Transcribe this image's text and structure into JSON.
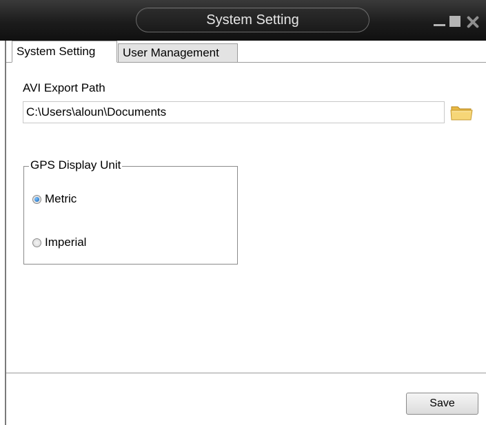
{
  "window": {
    "title": "System Setting"
  },
  "tabs": [
    {
      "label": "System Setting",
      "active": true
    },
    {
      "label": "User Management",
      "active": false
    }
  ],
  "export": {
    "label": "AVI Export Path",
    "path_value": "C:\\Users\\aloun\\Documents",
    "browse_icon": "folder-icon"
  },
  "gps": {
    "group_label": "GPS Display Unit",
    "options": [
      {
        "label": "Metric",
        "selected": true
      },
      {
        "label": "Imperial",
        "selected": false
      }
    ]
  },
  "footer": {
    "save_label": "Save"
  },
  "colors": {
    "titlebar": "#1c1c1c",
    "title_text": "#e6e6e6",
    "accent_radio": "#0e5fb5",
    "folder": "#f0c75a"
  }
}
